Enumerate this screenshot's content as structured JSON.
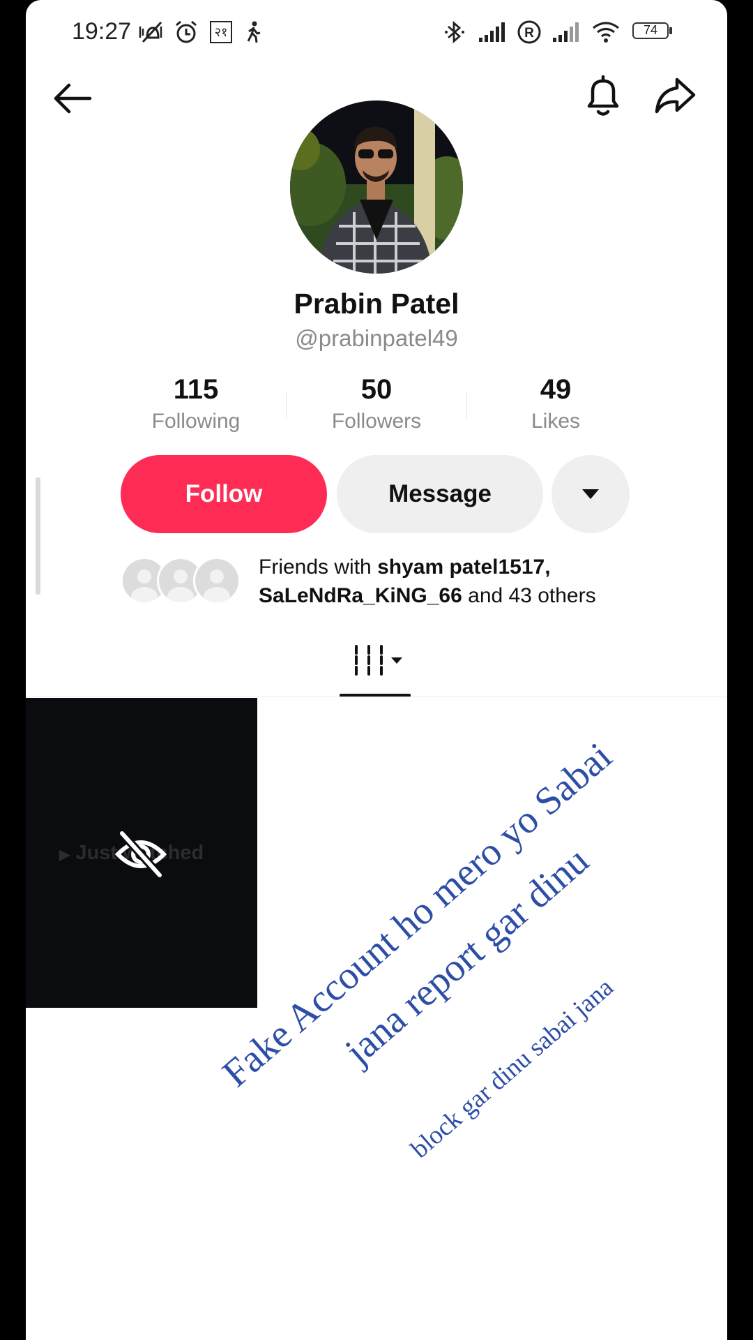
{
  "status_bar": {
    "time": "19:27",
    "region_glyph": "२१",
    "battery": "74",
    "icons": [
      "mute-vibrate-icon",
      "alarm-icon",
      "walking-icon",
      "bluetooth-icon",
      "signal-icon",
      "roaming-icon",
      "signal-icon",
      "wifi-icon",
      "battery-icon"
    ]
  },
  "header": {
    "back_icon": "arrow-left-icon",
    "bell_icon": "bell-icon",
    "share_icon": "share-icon"
  },
  "profile": {
    "display_name": "Prabin Patel",
    "username": "@prabinpatel49",
    "stats": [
      {
        "value": "115",
        "label": "Following"
      },
      {
        "value": "50",
        "label": "Followers"
      },
      {
        "value": "49",
        "label": "Likes"
      }
    ]
  },
  "actions": {
    "follow": "Follow",
    "message": "Message",
    "more_icon": "caret-down-icon"
  },
  "friends": {
    "prefix": "Friends with ",
    "name1": "shyam patel1517",
    "comma": ",",
    "name2": "SaLeNdRa_KiNG_66",
    "suffix": " and 43 others"
  },
  "tabs": {
    "videos_icon": "grid-icon"
  },
  "video_tile": {
    "label": "Just watched",
    "icon": "eye-off-icon"
  },
  "overlay_text": {
    "line1": "Fake Account ho mero yo Sabai",
    "line2": "jana report gar dinu",
    "line3": "block gar dinu sabai jana"
  },
  "colors": {
    "follow": "#fe2c55",
    "handwriting": "#2d4ea6"
  }
}
